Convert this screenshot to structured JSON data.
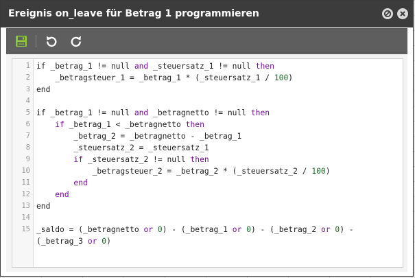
{
  "dialog": {
    "title": "Ereignis on_leave für Betrag 1 programmieren"
  },
  "toolbar": {
    "save": "save-icon",
    "undo": "undo-icon",
    "redo": "redo-icon"
  },
  "editor": {
    "lines": [
      {
        "number": "1",
        "tokens": [
          [
            "t",
            "if _betrag_1 != null "
          ],
          [
            "k",
            "and"
          ],
          [
            "t",
            " _steuersatz_1 != null "
          ],
          [
            "k",
            "then"
          ]
        ]
      },
      {
        "number": "2",
        "tokens": [
          [
            "t",
            "    _betragsteuer_1 = _betrag_1 * (_steuersatz_1 / "
          ],
          [
            "n",
            "100"
          ],
          [
            "t",
            ")"
          ]
        ]
      },
      {
        "number": "3",
        "tokens": [
          [
            "t",
            "end"
          ]
        ]
      },
      {
        "number": "4",
        "tokens": []
      },
      {
        "number": "5",
        "tokens": [
          [
            "t",
            "if _betrag_1 != null "
          ],
          [
            "k",
            "and"
          ],
          [
            "t",
            " _betragnetto != null "
          ],
          [
            "k",
            "then"
          ]
        ]
      },
      {
        "number": "6",
        "tokens": [
          [
            "t",
            "    "
          ],
          [
            "k",
            "if"
          ],
          [
            "t",
            " _betrag_1 < _betragnetto "
          ],
          [
            "k",
            "then"
          ]
        ]
      },
      {
        "number": "7",
        "tokens": [
          [
            "t",
            "        _betrag_2 = _betragnetto - _betrag_1"
          ]
        ]
      },
      {
        "number": "8",
        "tokens": [
          [
            "t",
            "        _steuersatz_2 = _steuersatz_1"
          ]
        ]
      },
      {
        "number": "9",
        "tokens": [
          [
            "t",
            "        "
          ],
          [
            "k",
            "if"
          ],
          [
            "t",
            " _steuersatz_2 != null "
          ],
          [
            "k",
            "then"
          ]
        ]
      },
      {
        "number": "10",
        "tokens": [
          [
            "t",
            "            _betragsteuer_2 = _betrag_2 * (_steuersatz_2 / "
          ],
          [
            "n",
            "100"
          ],
          [
            "t",
            ")"
          ]
        ]
      },
      {
        "number": "11",
        "tokens": [
          [
            "t",
            "        "
          ],
          [
            "k",
            "end"
          ]
        ]
      },
      {
        "number": "12",
        "tokens": [
          [
            "t",
            "    "
          ],
          [
            "k",
            "end"
          ]
        ]
      },
      {
        "number": "13",
        "tokens": [
          [
            "t",
            "end"
          ]
        ]
      },
      {
        "number": "14",
        "tokens": []
      },
      {
        "number": "15",
        "tokens": [
          [
            "t",
            "_saldo = (_betragnetto "
          ],
          [
            "k",
            "or"
          ],
          [
            "t",
            " "
          ],
          [
            "n",
            "0"
          ],
          [
            "t",
            ") - (_betrag_1 "
          ],
          [
            "k",
            "or"
          ],
          [
            "t",
            " "
          ],
          [
            "n",
            "0"
          ],
          [
            "t",
            ") - (_betrag_2 "
          ],
          [
            "k",
            "or"
          ],
          [
            "t",
            " "
          ],
          [
            "n",
            "0"
          ],
          [
            "t",
            ") -"
          ]
        ]
      },
      {
        "number": "",
        "tokens": [
          [
            "t",
            "(_betrag_3 "
          ],
          [
            "k",
            "or"
          ],
          [
            "t",
            " "
          ],
          [
            "n",
            "0"
          ],
          [
            "t",
            ")"
          ]
        ]
      }
    ]
  },
  "colors": {
    "keyword": "#7a0f99",
    "number": "#1a6b2a",
    "titlebar": "#3c3c3c",
    "toolbar": "#5e5e5e",
    "save_icon": "#8cc63f"
  }
}
